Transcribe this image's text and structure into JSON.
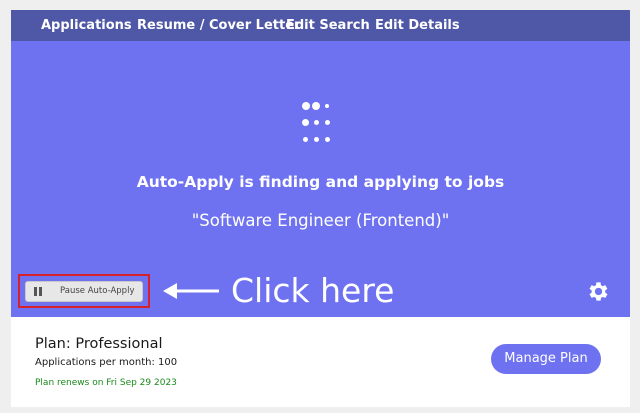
{
  "nav": {
    "items": [
      {
        "label": "Applications"
      },
      {
        "label": "Resume / Cover Letter"
      },
      {
        "label": "Edit Search"
      },
      {
        "label": "Edit Details"
      }
    ]
  },
  "hero": {
    "status_text": "Auto-Apply is finding and applying to jobs",
    "search_query": "\"Software Engineer (Frontend)\"",
    "pause_button_label": "Pause Auto-Apply",
    "annotation_text": "Click here",
    "background_color": "#6e72f1"
  },
  "plan": {
    "title": "Plan: Professional",
    "applications_per_month": "Applications per month: 100",
    "renewal_text": "Plan renews on Fri Sep 29 2023",
    "manage_button_label": "Manage Plan"
  },
  "colors": {
    "nav_bg": "#4f58a6",
    "accent": "#6e72f1",
    "highlight_border": "#d8202a",
    "renewal_text": "#1a8a1a"
  },
  "icons": [
    "loading-dots-icon",
    "pause-icon",
    "left-arrow-icon",
    "gear-icon"
  ]
}
